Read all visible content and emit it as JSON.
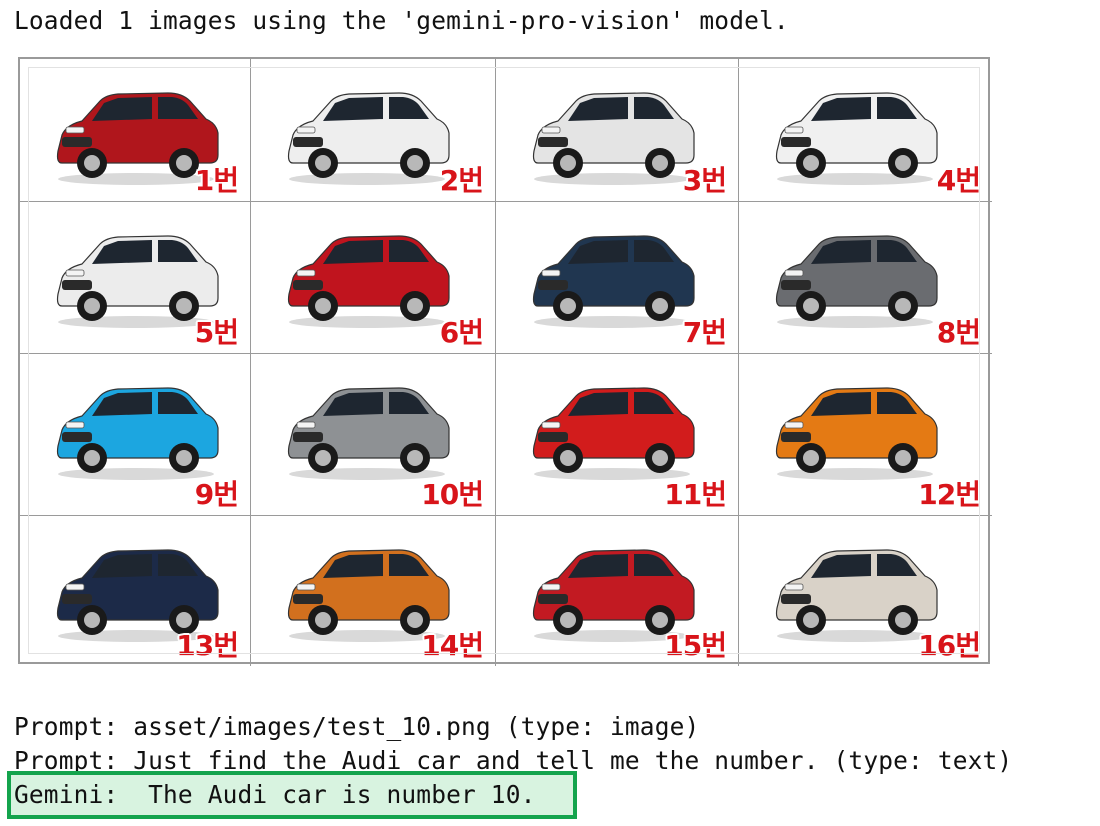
{
  "console": {
    "status": "Loaded 1 images using the 'gemini-pro-vision' model.",
    "prompt_image": "Prompt: asset/images/test_10.png (type: image)",
    "prompt_text": "Prompt: Just find the Audi car and tell me the number. (type: text)",
    "response": "Gemini:  The Audi car is number 10."
  },
  "highlight_color": "#14a44d",
  "cars": [
    {
      "label": "1번",
      "color": "#b0161c"
    },
    {
      "label": "2번",
      "color": "#eeeeee"
    },
    {
      "label": "3번",
      "color": "#e4e4e4"
    },
    {
      "label": "4번",
      "color": "#f0f0f0"
    },
    {
      "label": "5번",
      "color": "#ececec"
    },
    {
      "label": "6번",
      "color": "#c0141e"
    },
    {
      "label": "7번",
      "color": "#203650"
    },
    {
      "label": "8번",
      "color": "#6a6c70"
    },
    {
      "label": "9번",
      "color": "#1ca6e0"
    },
    {
      "label": "10번",
      "color": "#8e9194"
    },
    {
      "label": "11번",
      "color": "#d21c1c"
    },
    {
      "label": "12번",
      "color": "#e47a14"
    },
    {
      "label": "13번",
      "color": "#1c2a48"
    },
    {
      "label": "14번",
      "color": "#d2701e"
    },
    {
      "label": "15번",
      "color": "#c21a22"
    },
    {
      "label": "16번",
      "color": "#d9d2c8"
    }
  ]
}
